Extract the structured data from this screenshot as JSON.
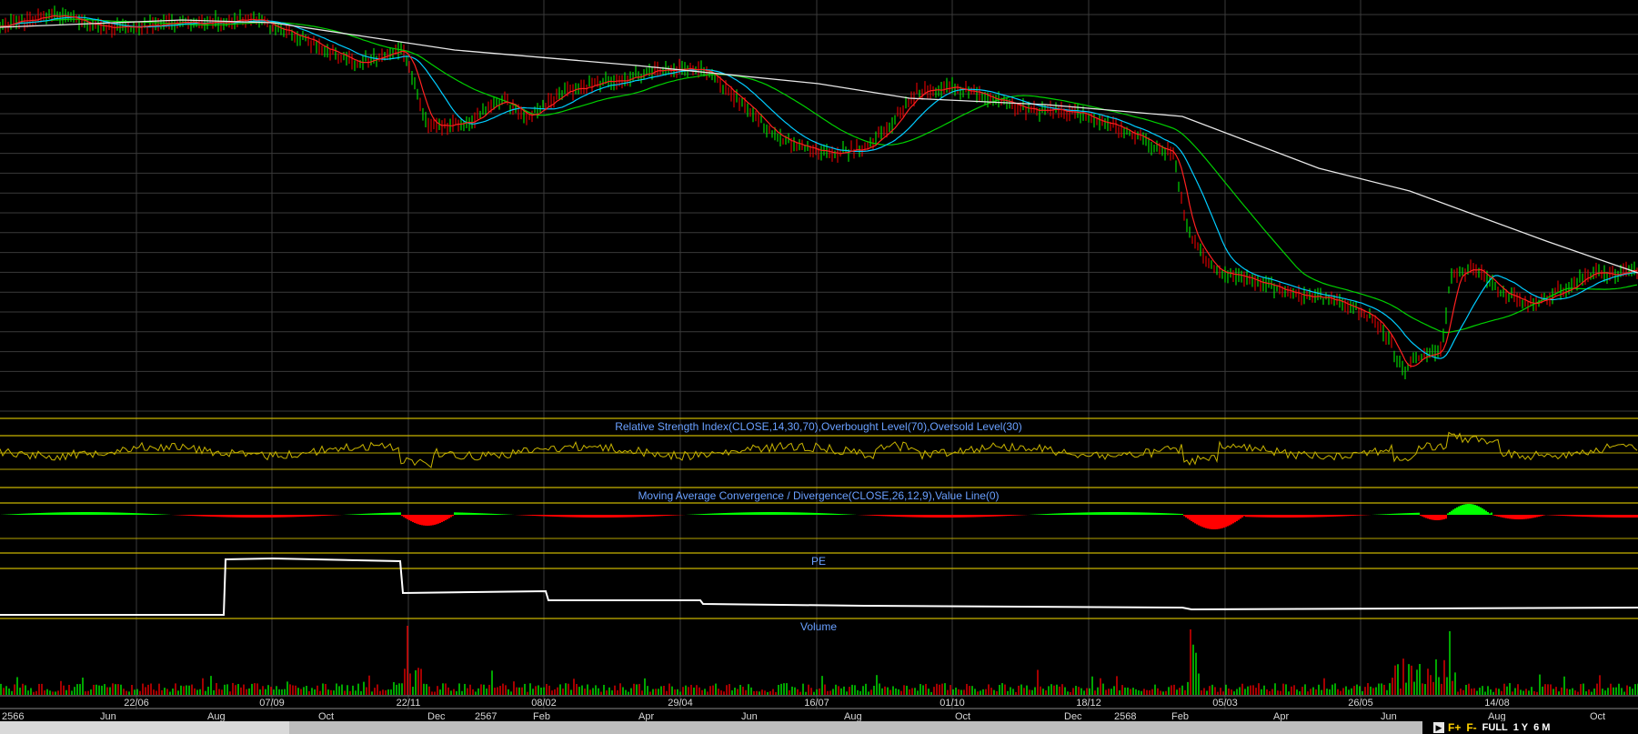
{
  "chart_data": [
    {
      "type": "line",
      "panel": "price",
      "series": [],
      "note_series": [
        "price-candles",
        "ma-short-red",
        "ma-medium-cyan",
        "ma-long-green",
        "ma-200-white"
      ]
    },
    {
      "type": "line",
      "panel": "rsi",
      "title": "Relative Strength Index(CLOSE,14,30,70),Overbought Level(70),Oversold Level(30)",
      "levels": [
        70,
        30
      ]
    },
    {
      "type": "area",
      "panel": "macd",
      "title": "Moving Average Convergence / Divergence(CLOSE,26,12,9),Value Line(0)",
      "levels": [
        0
      ]
    },
    {
      "type": "line",
      "panel": "pe",
      "title": "PE"
    },
    {
      "type": "bar",
      "panel": "volume",
      "title": "Volume"
    }
  ],
  "x_axis": {
    "upper_ticks": [
      "22/06",
      "07/09",
      "22/11",
      "08/02",
      "29/04",
      "16/07",
      "01/10",
      "18/12",
      "05/03",
      "26/05",
      "14/08"
    ],
    "lower_ticks": [
      "2566",
      "Jun",
      "Aug",
      "Oct",
      "Dec",
      "2567",
      "Feb",
      "Apr",
      "Jun",
      "Aug",
      "Oct",
      "Dec",
      "2568",
      "Feb",
      "Apr",
      "Jun",
      "Aug",
      "Oct"
    ]
  },
  "footer": {
    "arrow": "▶",
    "buttons": [
      "FULL",
      "1 Y",
      "6 M"
    ]
  },
  "colors": {
    "grid": "#3a3a3a",
    "panel_border": "#c8b400",
    "title": "#6aa0ff",
    "up": "#00ff00",
    "down": "#ff0000",
    "ma_short": "#ff2020",
    "ma_medium": "#00ccff",
    "ma_long": "#00d000",
    "ma_200": "#e8e8e8",
    "rsi_line": "#c8b400",
    "pe_line": "#ffffff"
  }
}
